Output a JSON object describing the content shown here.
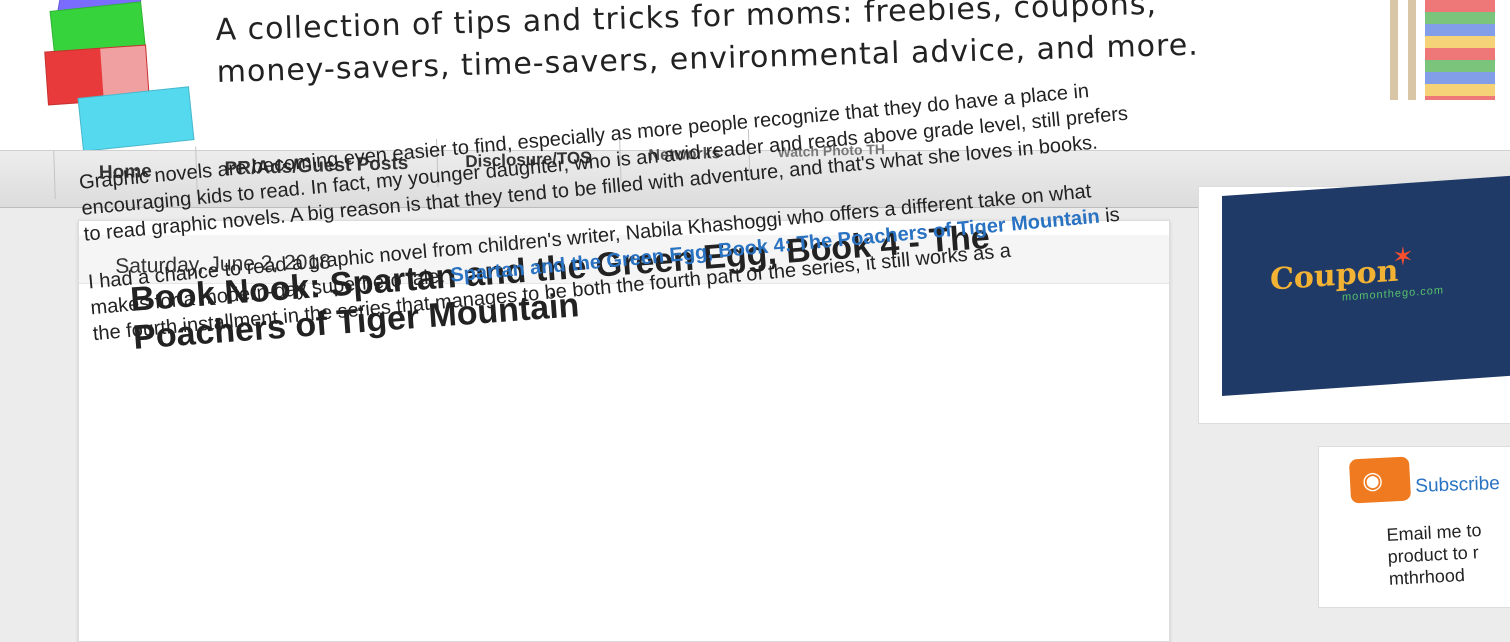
{
  "header": {
    "tagline_line1": "A collection of tips and tricks for moms: freebies, coupons,",
    "tagline_line2": "money-savers, time-savers, environmental advice, and more."
  },
  "nav": {
    "tabs": [
      {
        "label": "Home"
      },
      {
        "label": "PR/Ads/Guest Posts"
      },
      {
        "label": "Disclosure/TOS"
      },
      {
        "label": "Networks"
      },
      {
        "label": "Watch Photo TH"
      }
    ]
  },
  "post": {
    "date": "Saturday, June 2, 2018",
    "title_line1": "Book Nook: Spartan and the Green Egg, Book 4 - The",
    "title_line2": "Poachers of Tiger Mountain",
    "paragraph1": "Graphic novels are becoming even easier to find, especially as more people recognize that they do have a place in encouraging kids to read. In fact, my younger daughter, who is an avid reader and reads above grade level, still prefers to read graphic novels. A big reason is that they tend to be filled with adventure, and that's what she loves in books.",
    "paragraph2_a": "I had a chance to read a graphic novel from children's writer, Nabila Khashoggi who offers a different take on what makes for a modern-day superhero tale.",
    "paragraph2_link": "Spartan and the Green Egg, Book 4: The Poachers of Tiger Mountain",
    "paragraph2_b": "is the fourth installment in the series that manages to be both",
    "paragraph2_c": "the fourth part of the series, it still works as a"
  },
  "sidebar": {
    "ad_text": "Coupon",
    "ad_subtext": "momonthego.com",
    "subscribe_label": "Subscribe",
    "email_text": "Email me to product to r mthrhood"
  },
  "colors": {
    "link": "#2a72c2",
    "ad_background": "#1f3a66",
    "ad_text": "#f2b233",
    "rss": "#f07a1f"
  }
}
